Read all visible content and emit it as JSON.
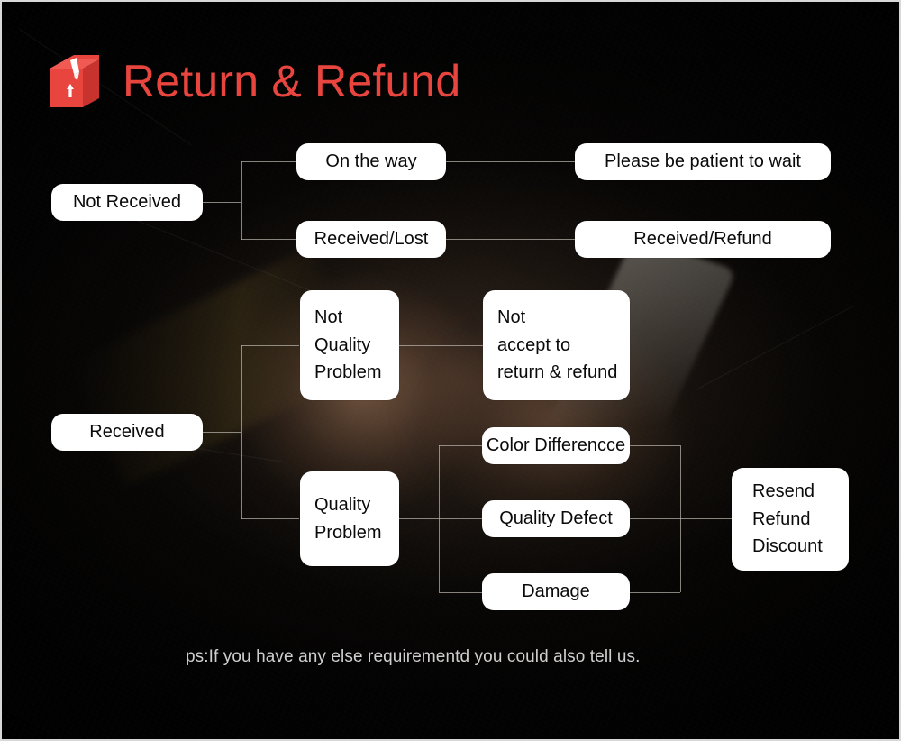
{
  "page": {
    "background_color": "#060505",
    "border_color": "#d8d8d8",
    "accent_color": "#e8453f",
    "node_fill": "#ffffff",
    "node_text_color": "#0a0a0a",
    "connector_color": "#b9b4ab"
  },
  "header": {
    "icon_name": "package-box-icon",
    "title": "Return & Refund"
  },
  "flow": {
    "branch_not_received": {
      "root": "Not Received",
      "children": [
        {
          "condition": "On the way",
          "action": "Please be patient to wait"
        },
        {
          "condition": "Received/Lost",
          "action": "Received/Refund"
        }
      ]
    },
    "branch_received": {
      "root": "Received",
      "children": [
        {
          "condition": "Not\nQuality\nProblem",
          "condition_lines": [
            "Not",
            "Quality",
            "Problem"
          ],
          "action": "Not\naccept to\nreturn & refund",
          "action_lines": [
            "Not",
            "accept to",
            "return & refund"
          ]
        },
        {
          "condition": "Quality\nProblem",
          "condition_lines": [
            "Quality",
            "Problem"
          ],
          "reasons": [
            "Color Differencce",
            "Quality Defect",
            "Damage"
          ],
          "action": "Resend\nRefund\nDiscount",
          "action_lines": [
            "Resend",
            "Refund",
            "Discount"
          ]
        }
      ]
    }
  },
  "footer": {
    "note": "ps:If you have any else requirementd you could also tell us."
  }
}
